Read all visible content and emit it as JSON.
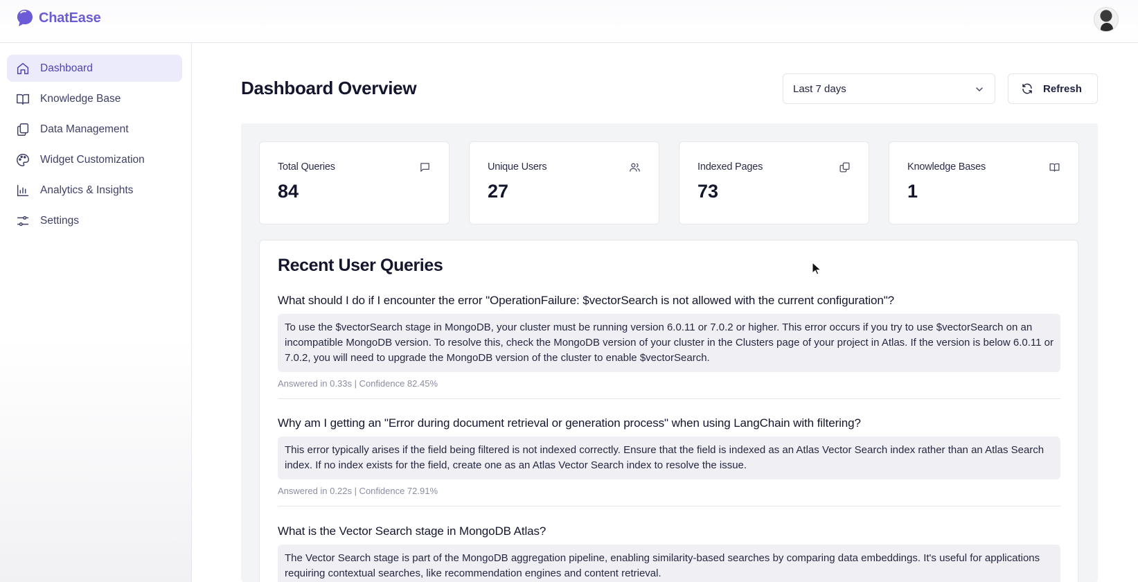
{
  "app": {
    "name": "ChatEase"
  },
  "sidebar": {
    "items": [
      {
        "label": "Dashboard",
        "icon": "home-icon",
        "active": true
      },
      {
        "label": "Knowledge Base",
        "icon": "book-icon",
        "active": false
      },
      {
        "label": "Data Management",
        "icon": "files-icon",
        "active": false
      },
      {
        "label": "Widget Customization",
        "icon": "palette-icon",
        "active": false
      },
      {
        "label": "Analytics & Insights",
        "icon": "bar-chart-icon",
        "active": false
      },
      {
        "label": "Settings",
        "icon": "sliders-icon",
        "active": false
      }
    ]
  },
  "header": {
    "title": "Dashboard Overview",
    "range_select": {
      "value": "Last 7 days"
    },
    "refresh_label": "Refresh"
  },
  "stats": [
    {
      "label": "Total Queries",
      "value": "84",
      "icon": "message-icon"
    },
    {
      "label": "Unique Users",
      "value": "27",
      "icon": "users-icon"
    },
    {
      "label": "Indexed Pages",
      "value": "73",
      "icon": "copy-icon"
    },
    {
      "label": "Knowledge Bases",
      "value": "1",
      "icon": "book-icon"
    }
  ],
  "recent": {
    "title": "Recent User Queries",
    "queries": [
      {
        "question": "What should I do if I encounter the error \"OperationFailure: $vectorSearch is not allowed with the current configuration\"?",
        "answer": "To use the $vectorSearch stage in MongoDB, your cluster must be running version 6.0.11 or 7.0.2 or higher. This error occurs if you try to use $vectorSearch on an incompatible MongoDB version. To resolve this, check the MongoDB version of your cluster in the Clusters page of your project in Atlas. If the version is below 6.0.11 or 7.0.2, you will need to upgrade the MongoDB version of the cluster to enable $vectorSearch.",
        "meta": "Answered in 0.33s | Confidence 82.45%"
      },
      {
        "question": "Why am I getting an \"Error during document retrieval or generation process\" when using LangChain with filtering?",
        "answer": "This error typically arises if the field being filtered is not indexed correctly. Ensure that the field is indexed as an Atlas Vector Search index rather than an Atlas Search index. If no index exists for the field, create one as an Atlas Vector Search index to resolve the issue.",
        "meta": "Answered in 0.22s | Confidence 72.91%"
      },
      {
        "question": "What is the Vector Search stage in MongoDB Atlas?",
        "answer": "The Vector Search stage is part of the MongoDB aggregation pipeline, enabling similarity-based searches by comparing data embeddings. It's useful for applications requiring contextual searches, like recommendation engines and content retrieval.",
        "meta": ""
      }
    ]
  },
  "colors": {
    "accent": "#6b5bd6",
    "active_bg": "#ecebfb",
    "panel_bg": "#f3f4f6"
  }
}
